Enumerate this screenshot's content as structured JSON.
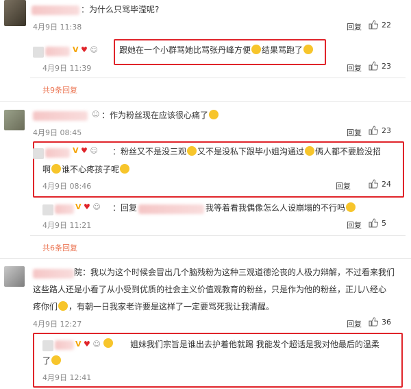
{
  "comments": [
    {
      "text": "：为什么只骂毕滢呢?",
      "time": "4月9日 11:38",
      "reply": "回复",
      "likes": "22"
    },
    {
      "text_a": "跟她在一个小群骂她比骂张丹峰方便",
      "text_b": "结果骂跑了",
      "time": "4月9日 11:39",
      "reply": "回复",
      "likes": "23"
    },
    {
      "more": "共9条回复"
    },
    {
      "text": "：作为粉丝现在应该很心痛了",
      "time": "4月9日 08:45",
      "reply": "回复",
      "likes": "23"
    },
    {
      "text_a": "：粉丝又不是没三观",
      "text_b": "又不是没私下跟毕小姐沟通过",
      "text_c": "俩人都不要脸没招",
      "text_d": "啊",
      "text_e": "谁不心疼孩子呢",
      "time": "4月9日 08:46",
      "reply": "回复",
      "likes": "24"
    },
    {
      "prefix": "：回复",
      "text": "我等着看我偶像怎么人设崩塌的不行吗",
      "time": "4月9日 11:21",
      "reply": "回复",
      "likes": "5"
    },
    {
      "more": "共6条回复"
    },
    {
      "text_a": "院：我以为这个时候会冒出几个脑残粉为这种三观道德沦丧的人极力辩解，不过看来我们",
      "text_b": "这些路人还是小看了从小受到优质的社会主义价值观教育的粉丝，只是作为他的粉丝，正儿八经心",
      "text_c": "疼你们",
      "text_d": "，有朝一日我家老许要是这样了一定要骂死我让我清醒。",
      "time": "4月9日 12:27",
      "reply": "回复",
      "likes": "36"
    },
    {
      "text_a": "姐妹我们宗旨是谁出去护着他就踢 我能发个超话是我对他最后的温柔",
      "text_b": "了",
      "time": "4月9日 12:41"
    }
  ]
}
